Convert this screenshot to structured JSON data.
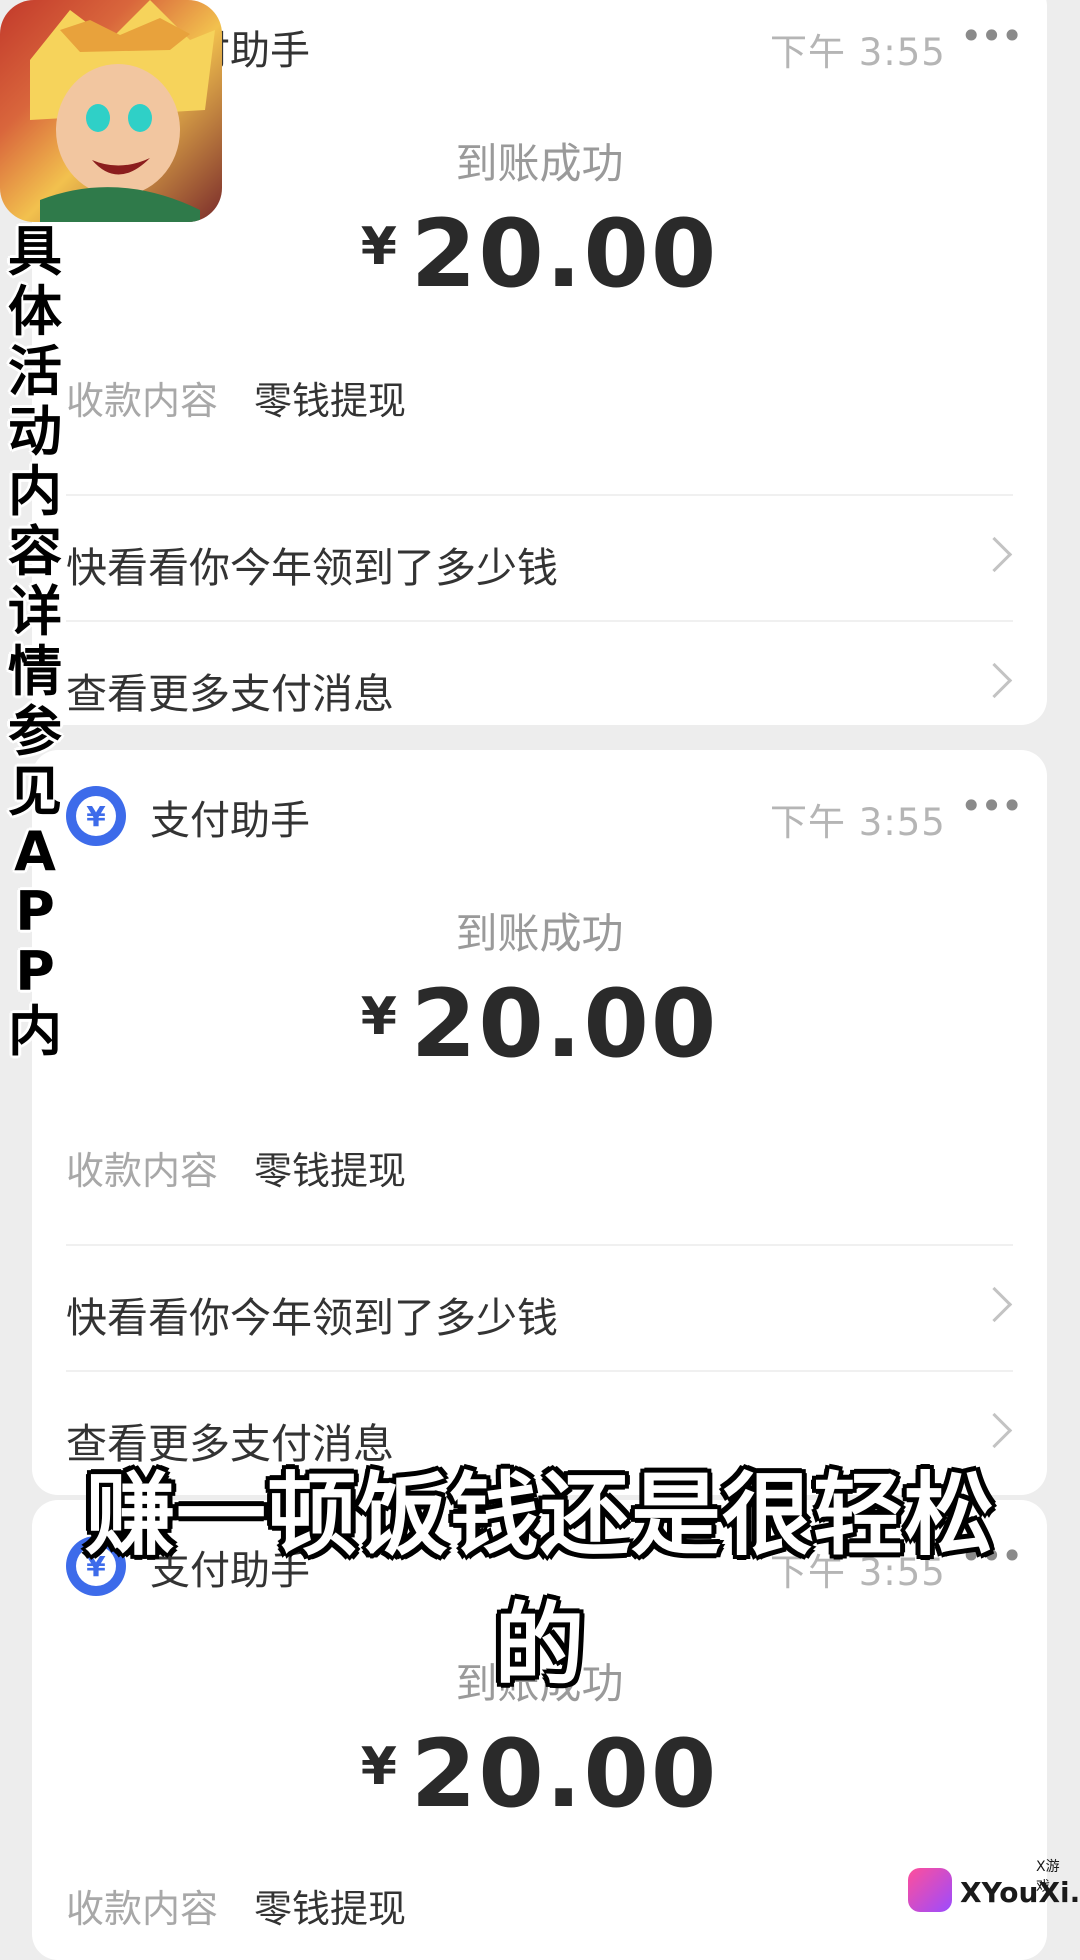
{
  "overlay": {
    "vertical_text": "具体活动内容详情参见APP内",
    "subtitle": "赚一顿饭钱还是很轻松的",
    "watermark": "XYouXi.net",
    "watermark_small": "X游戏"
  },
  "cards": [
    {
      "app_name": "支付助手",
      "time": "下午 3:55",
      "more": "•••",
      "status": "到账成功",
      "currency": "¥",
      "amount": "20.00",
      "detail_label": "收款内容",
      "detail_value": "零钱提现",
      "link1": "快看看你今年领到了多少钱",
      "link2": "查看更多支付消息"
    },
    {
      "app_name": "支付助手",
      "time": "下午 3:55",
      "more": "•••",
      "status": "到账成功",
      "currency": "¥",
      "amount": "20.00",
      "detail_label": "收款内容",
      "detail_value": "零钱提现",
      "link1": "快看看你今年领到了多少钱",
      "link2": "查看更多支付消息"
    },
    {
      "app_name": "支付助手",
      "time": "下午 3:55",
      "more": "•••",
      "status": "到账成功",
      "currency": "¥",
      "amount": "20.00",
      "detail_label": "收款内容",
      "detail_value": "零钱提现"
    }
  ],
  "icons": {
    "payment_icon": "yuan-coin-icon",
    "more_icon": "ellipsis-icon",
    "chevron_icon": "chevron-right-icon"
  }
}
